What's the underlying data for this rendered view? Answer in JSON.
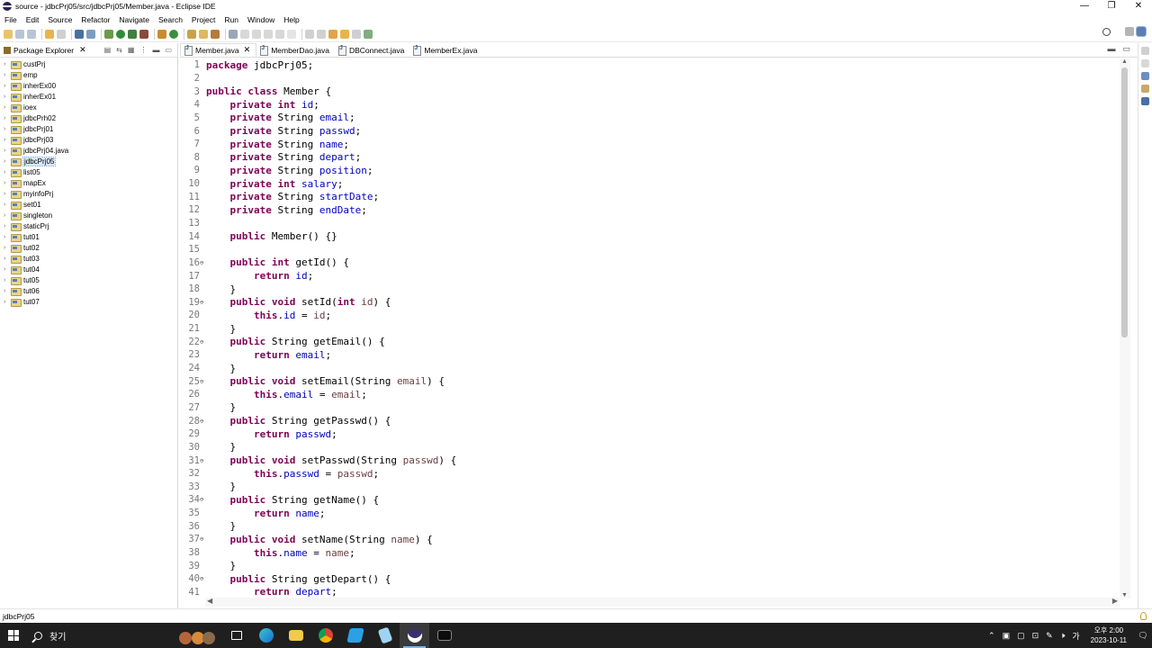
{
  "window": {
    "title": "source - jdbcPrj05/src/jdbcPrj05/Member.java - Eclipse IDE",
    "controls": {
      "minimize": "—",
      "restore": "❐",
      "close": "✕"
    }
  },
  "menu": [
    "File",
    "Edit",
    "Source",
    "Refactor",
    "Navigate",
    "Search",
    "Project",
    "Run",
    "Window",
    "Help"
  ],
  "explorer": {
    "title": "Package Explorer",
    "projects": [
      "custPrj",
      "emp",
      "inherEx00",
      "inherEx01",
      "ioex",
      "jdbcPrh02",
      "jdbcPrj01",
      "jdbcPrj03",
      "jdbcPrj04.java",
      "jdbcPrj05",
      "list05",
      "mapEx",
      "myinfoPrj",
      "set01",
      "singleton",
      "staticPrj",
      "tut01",
      "tut02",
      "tut03",
      "tut04",
      "tut05",
      "tut06",
      "tut07"
    ],
    "selected": "jdbcPrj05"
  },
  "tabs": [
    {
      "label": "Member.java",
      "active": true
    },
    {
      "label": "MemberDao.java",
      "active": false
    },
    {
      "label": "DBConnect.java",
      "active": false
    },
    {
      "label": "MemberEx.java",
      "active": false
    }
  ],
  "code": [
    {
      "n": "1",
      "fold": "",
      "html": "<span class='kw'>package</span> jdbcPrj05;"
    },
    {
      "n": "2",
      "fold": "",
      "html": ""
    },
    {
      "n": "3",
      "fold": "",
      "html": "<span class='kw'>public class</span> Member {"
    },
    {
      "n": "4",
      "fold": "",
      "html": "    <span class='kw'>private int</span> <span class='fld'>id</span>;"
    },
    {
      "n": "5",
      "fold": "",
      "html": "    <span class='kw'>private</span> String <span class='fld'>email</span>;"
    },
    {
      "n": "6",
      "fold": "",
      "html": "    <span class='kw'>private</span> String <span class='fld'>passwd</span>;"
    },
    {
      "n": "7",
      "fold": "",
      "html": "    <span class='kw'>private</span> String <span class='fld'>name</span>;"
    },
    {
      "n": "8",
      "fold": "",
      "html": "    <span class='kw'>private</span> String <span class='fld'>depart</span>;"
    },
    {
      "n": "9",
      "fold": "",
      "html": "    <span class='kw'>private</span> String <span class='fld'>position</span>;"
    },
    {
      "n": "10",
      "fold": "",
      "html": "    <span class='kw'>private int</span> <span class='fld'>salary</span>;"
    },
    {
      "n": "11",
      "fold": "",
      "html": "    <span class='kw'>private</span> String <span class='fld'>startDate</span>;"
    },
    {
      "n": "12",
      "fold": "",
      "html": "    <span class='kw'>private</span> String <span class='fld'>endDate</span>;"
    },
    {
      "n": "13",
      "fold": "",
      "html": ""
    },
    {
      "n": "14",
      "fold": "",
      "html": "    <span class='kw'>public</span> Member() {}"
    },
    {
      "n": "15",
      "fold": "",
      "html": ""
    },
    {
      "n": "16",
      "fold": "⊖",
      "html": "    <span class='kw'>public int</span> getId() {"
    },
    {
      "n": "17",
      "fold": "",
      "html": "        <span class='kw'>return</span> <span class='fld'>id</span>;"
    },
    {
      "n": "18",
      "fold": "",
      "html": "    }"
    },
    {
      "n": "19",
      "fold": "⊖",
      "html": "    <span class='kw'>public void</span> setId(<span class='kw'>int</span> <span class='prm'>id</span>) {"
    },
    {
      "n": "20",
      "fold": "",
      "html": "        <span class='kw'>this</span>.<span class='fld'>id</span> = <span class='prm'>id</span>;"
    },
    {
      "n": "21",
      "fold": "",
      "html": "    }"
    },
    {
      "n": "22",
      "fold": "⊖",
      "html": "    <span class='kw'>public</span> String getEmail() {"
    },
    {
      "n": "23",
      "fold": "",
      "html": "        <span class='kw'>return</span> <span class='fld'>email</span>;"
    },
    {
      "n": "24",
      "fold": "",
      "html": "    }"
    },
    {
      "n": "25",
      "fold": "⊖",
      "html": "    <span class='kw'>public void</span> setEmail(String <span class='prm'>email</span>) {"
    },
    {
      "n": "26",
      "fold": "",
      "html": "        <span class='kw'>this</span>.<span class='fld'>email</span> = <span class='prm'>email</span>;"
    },
    {
      "n": "27",
      "fold": "",
      "html": "    }"
    },
    {
      "n": "28",
      "fold": "⊖",
      "html": "    <span class='kw'>public</span> String getPasswd() {"
    },
    {
      "n": "29",
      "fold": "",
      "html": "        <span class='kw'>return</span> <span class='fld'>passwd</span>;"
    },
    {
      "n": "30",
      "fold": "",
      "html": "    }"
    },
    {
      "n": "31",
      "fold": "⊖",
      "html": "    <span class='kw'>public void</span> setPasswd(String <span class='prm'>passwd</span>) {"
    },
    {
      "n": "32",
      "fold": "",
      "html": "        <span class='kw'>this</span>.<span class='fld'>passwd</span> = <span class='prm'>passwd</span>;"
    },
    {
      "n": "33",
      "fold": "",
      "html": "    }"
    },
    {
      "n": "34",
      "fold": "⊖",
      "html": "    <span class='kw'>public</span> String getName() {"
    },
    {
      "n": "35",
      "fold": "",
      "html": "        <span class='kw'>return</span> <span class='fld'>name</span>;"
    },
    {
      "n": "36",
      "fold": "",
      "html": "    }"
    },
    {
      "n": "37",
      "fold": "⊖",
      "html": "    <span class='kw'>public void</span> setName(String <span class='prm'>name</span>) {"
    },
    {
      "n": "38",
      "fold": "",
      "html": "        <span class='kw'>this</span>.<span class='fld'>name</span> = <span class='prm'>name</span>;"
    },
    {
      "n": "39",
      "fold": "",
      "html": "    }"
    },
    {
      "n": "40",
      "fold": "⊖",
      "html": "    <span class='kw'>public</span> String getDepart() {"
    },
    {
      "n": "41",
      "fold": "",
      "html": "        <span class='kw'>return</span> <span class='fld'>depart</span>;"
    }
  ],
  "status": {
    "selection": "jdbcPrj05"
  },
  "taskbar": {
    "search_text": "찾기",
    "clock_time": "오후 2:00",
    "clock_date": "2023-10-11",
    "ime": "가"
  },
  "colors": {
    "keyword": "#7f0055",
    "field": "#0000c0",
    "param": "#6a3e3e"
  }
}
